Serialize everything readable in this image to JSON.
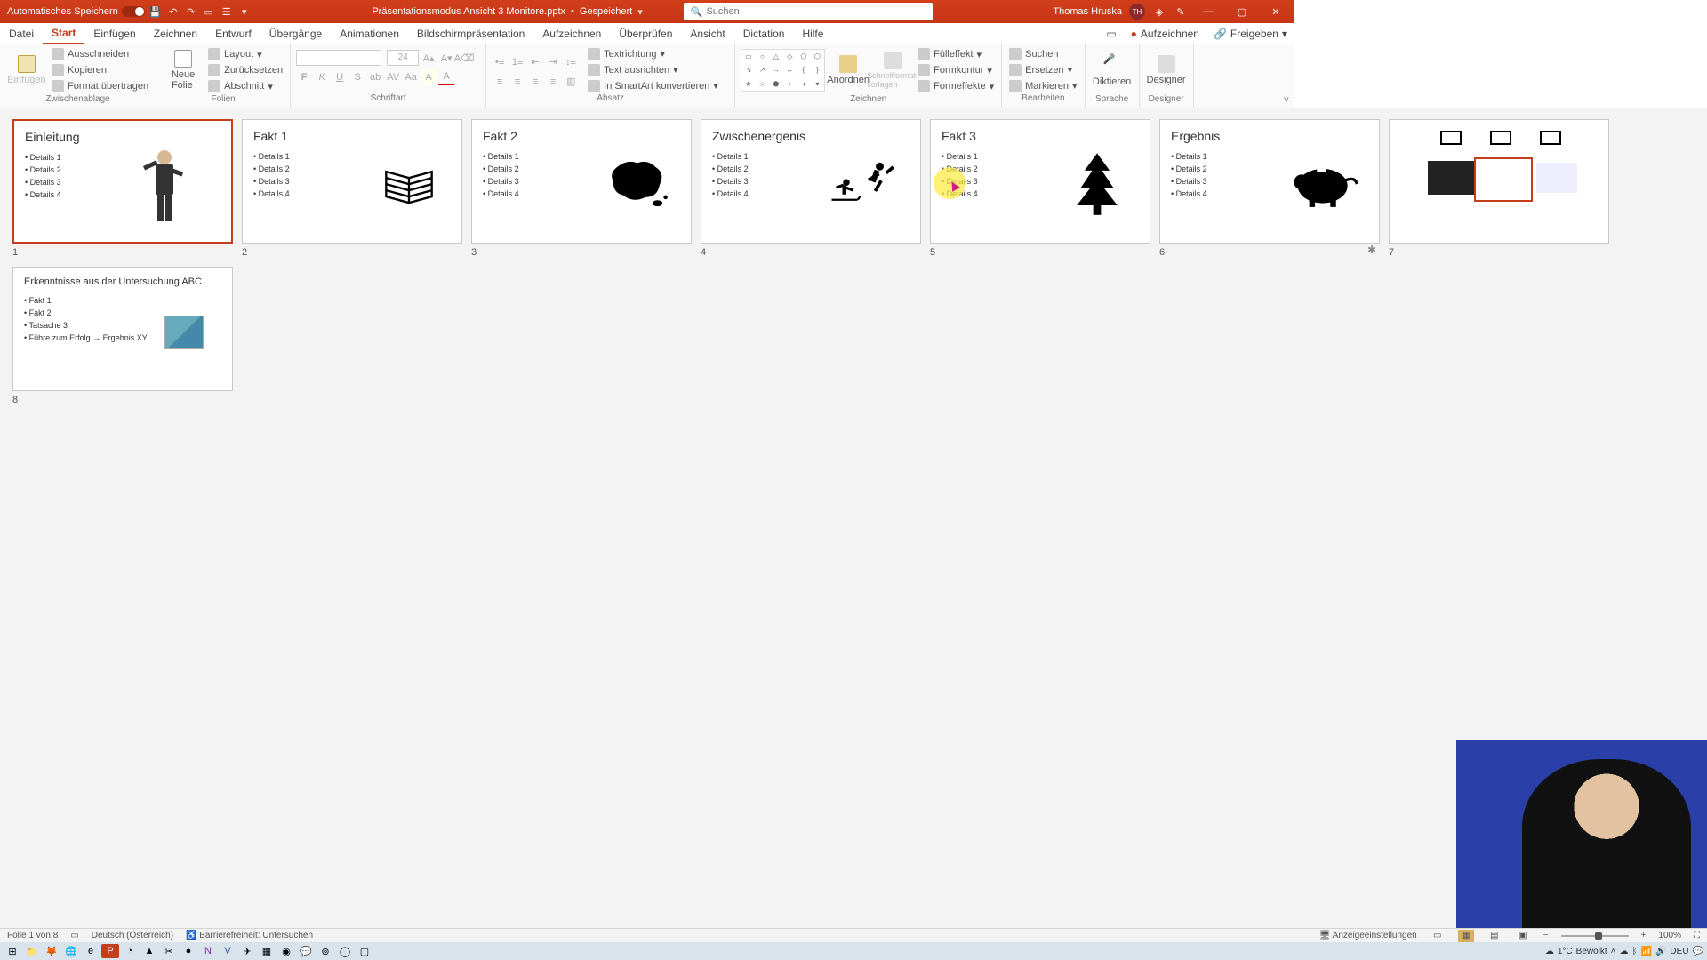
{
  "titlebar": {
    "autosave": "Automatisches Speichern",
    "filename": "Präsentationsmodus Ansicht 3 Monitore.pptx",
    "saved_state": "Gespeichert",
    "search_placeholder": "Suchen",
    "user_name": "Thomas Hruska",
    "user_initials": "TH"
  },
  "tabs": {
    "items": [
      "Datei",
      "Start",
      "Einfügen",
      "Zeichnen",
      "Entwurf",
      "Übergänge",
      "Animationen",
      "Bildschirmpräsentation",
      "Aufzeichnen",
      "Überprüfen",
      "Ansicht",
      "Dictation",
      "Hilfe"
    ],
    "active": "Start",
    "record": "Aufzeichnen",
    "share": "Freigeben"
  },
  "ribbon": {
    "clipboard": {
      "paste": "Einfügen",
      "cut": "Ausschneiden",
      "copy": "Kopieren",
      "format_painter": "Format übertragen",
      "group_label": "Zwischenablage"
    },
    "slides": {
      "new_slide": "Neue\nFolie",
      "layout": "Layout",
      "reset": "Zurücksetzen",
      "section": "Abschnitt",
      "group_label": "Folien"
    },
    "font": {
      "size": "24",
      "group_label": "Schriftart"
    },
    "paragraph": {
      "text_direction": "Textrichtung",
      "align_text": "Text ausrichten",
      "convert_smartart": "In SmartArt konvertieren",
      "group_label": "Absatz"
    },
    "drawing": {
      "arrange": "Anordnen",
      "quick_styles": "Schnellformat-\nvorlagen",
      "shape_fill": "Fülleffekt",
      "shape_outline": "Formkontur",
      "shape_effects": "Formeffekte",
      "group_label": "Zeichnen"
    },
    "editing": {
      "find": "Suchen",
      "replace": "Ersetzen",
      "select": "Markieren",
      "group_label": "Bearbeiten"
    },
    "voice": {
      "dictate": "Diktieren",
      "group_label": "Sprache"
    },
    "designer": {
      "designer": "Designer",
      "group_label": "Designer"
    }
  },
  "slides": [
    {
      "num": "1",
      "title": "Einleitung",
      "bullets": [
        "Details 1",
        "Details 2",
        "Details 3",
        "Details 4"
      ],
      "selected": true,
      "icon": "presenter"
    },
    {
      "num": "2",
      "title": "Fakt 1",
      "bullets": [
        "Details 1",
        "Details 2",
        "Details 3",
        "Details 4"
      ],
      "icon": "books"
    },
    {
      "num": "3",
      "title": "Fakt 2",
      "bullets": [
        "Details 1",
        "Details 2",
        "Details 3",
        "Details 4"
      ],
      "icon": "australia"
    },
    {
      "num": "4",
      "title": "Zwischenergenis",
      "bullets": [
        "Details 1",
        "Details 2",
        "Details 3",
        "Details 4"
      ],
      "icon": "sports"
    },
    {
      "num": "5",
      "title": "Fakt 3",
      "bullets": [
        "Details 1",
        "Details 2",
        "Details 3",
        "Details 4"
      ],
      "icon": "tree"
    },
    {
      "num": "6",
      "title": "Ergebnis",
      "bullets": [
        "Details 1",
        "Details 2",
        "Details 3",
        "Details 4"
      ],
      "icon": "piggy",
      "starred": true
    },
    {
      "num": "7",
      "title": "",
      "bullets": [],
      "icon": "screens"
    },
    {
      "num": "8",
      "title": "Erkenntnisse aus der Untersuchung ABC",
      "bullets": [
        "Fakt 1",
        "Fakt 2",
        "Tatsache 3",
        "Führe zum Erfolg → Ergebnis XY"
      ],
      "icon": "photo"
    }
  ],
  "statusbar": {
    "slide_info": "Folie 1 von 8",
    "language": "Deutsch (Österreich)",
    "accessibility": "Barrierefreiheit: Untersuchen",
    "display_settings": "Anzeigeeinstellungen",
    "zoom": "100%"
  },
  "taskbar": {
    "weather_temp": "1°C",
    "weather_text": "Bewölkt",
    "lang": "DEU"
  }
}
